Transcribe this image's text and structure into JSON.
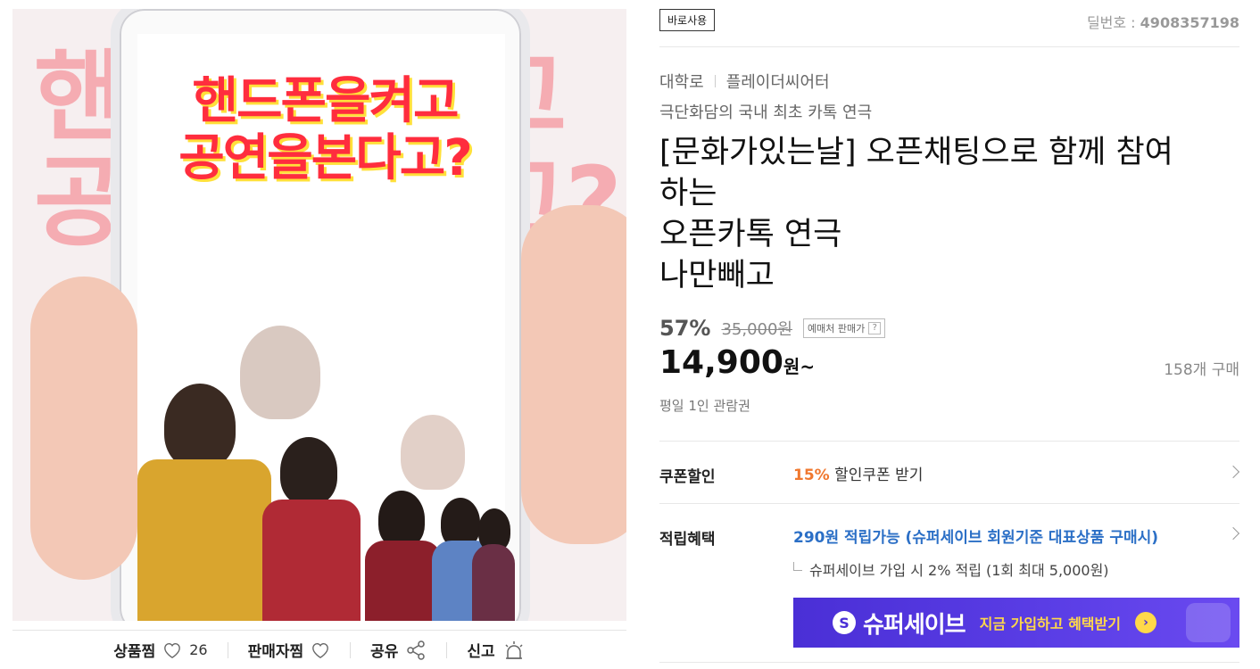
{
  "poster": {
    "headline_line1": "핸드폰을켜고",
    "headline_line2": "공연을본다고?",
    "bg_line1": "핸드폰을켜고",
    "bg_line2": "공연을본다고?"
  },
  "actions": {
    "wishlist_label": "상품찜",
    "wishlist_count": "26",
    "seller_wish_label": "판매자찜",
    "share_label": "공유",
    "report_label": "신고"
  },
  "product": {
    "badge": "바로사용",
    "deal_prefix": "딜번호 : ",
    "deal_number": "4908357198",
    "category": "대학로",
    "venue": "플레이더씨어터",
    "subtitle": "극단화담의 국내 최초 카톡 연극",
    "title": "[문화가있는날] 오픈채팅으로 함께 참여\n하는\n오픈카톡 연극\n나만빼고",
    "discount": "57%",
    "original_price": "35,000원",
    "price_tag": "예매처 판매가",
    "price_tag_help": "?",
    "price": "14,900",
    "price_unit": "원~",
    "purchase_count": "158개 구매",
    "price_note": "평일 1인 관람권"
  },
  "coupon": {
    "label": "쿠폰할인",
    "percent": "15%",
    "text": " 할인쿠폰 받기"
  },
  "points": {
    "label": "적립혜택",
    "text": "290원 적립가능 (슈퍼세이브 회원기준 대표상품 구매시)",
    "sub": "슈퍼세이브 가입 시 2% 적립 (1회 최대 5,000원)"
  },
  "banner": {
    "logo": "S",
    "brand": "슈퍼세이브",
    "cta": "지금 가입하고 혜택받기",
    "arrow": "›"
  },
  "colors": {
    "accent_orange": "#f0782f",
    "link_blue": "#2b6fc6",
    "banner_purple": "#4a2fd6",
    "poster_red": "#ff2d3e"
  }
}
